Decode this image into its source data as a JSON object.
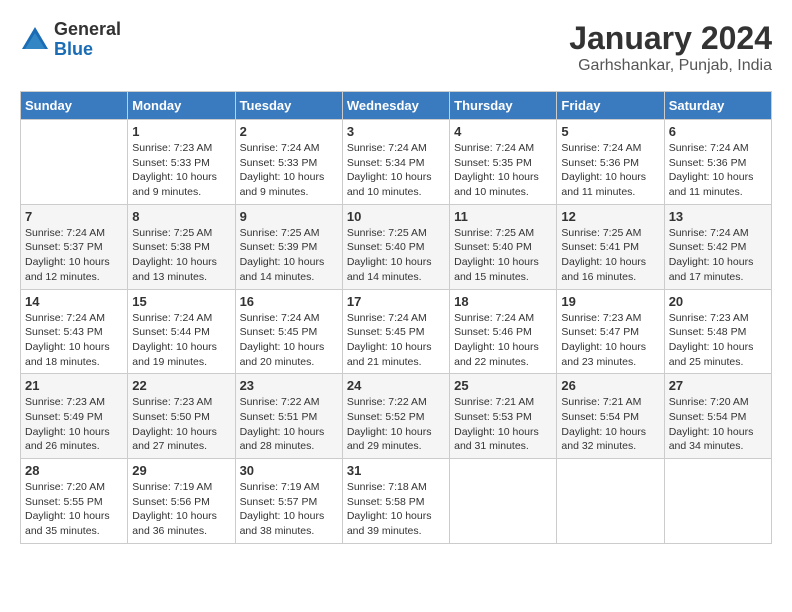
{
  "header": {
    "logo_general": "General",
    "logo_blue": "Blue",
    "title": "January 2024",
    "location": "Garhshankar, Punjab, India"
  },
  "days_of_week": [
    "Sunday",
    "Monday",
    "Tuesday",
    "Wednesday",
    "Thursday",
    "Friday",
    "Saturday"
  ],
  "weeks": [
    [
      {
        "num": "",
        "sunrise": "",
        "sunset": "",
        "daylight": ""
      },
      {
        "num": "1",
        "sunrise": "7:23 AM",
        "sunset": "5:33 PM",
        "daylight": "10 hours and 9 minutes."
      },
      {
        "num": "2",
        "sunrise": "7:24 AM",
        "sunset": "5:33 PM",
        "daylight": "10 hours and 9 minutes."
      },
      {
        "num": "3",
        "sunrise": "7:24 AM",
        "sunset": "5:34 PM",
        "daylight": "10 hours and 10 minutes."
      },
      {
        "num": "4",
        "sunrise": "7:24 AM",
        "sunset": "5:35 PM",
        "daylight": "10 hours and 10 minutes."
      },
      {
        "num": "5",
        "sunrise": "7:24 AM",
        "sunset": "5:36 PM",
        "daylight": "10 hours and 11 minutes."
      },
      {
        "num": "6",
        "sunrise": "7:24 AM",
        "sunset": "5:36 PM",
        "daylight": "10 hours and 11 minutes."
      }
    ],
    [
      {
        "num": "7",
        "sunrise": "7:24 AM",
        "sunset": "5:37 PM",
        "daylight": "10 hours and 12 minutes."
      },
      {
        "num": "8",
        "sunrise": "7:25 AM",
        "sunset": "5:38 PM",
        "daylight": "10 hours and 13 minutes."
      },
      {
        "num": "9",
        "sunrise": "7:25 AM",
        "sunset": "5:39 PM",
        "daylight": "10 hours and 14 minutes."
      },
      {
        "num": "10",
        "sunrise": "7:25 AM",
        "sunset": "5:40 PM",
        "daylight": "10 hours and 14 minutes."
      },
      {
        "num": "11",
        "sunrise": "7:25 AM",
        "sunset": "5:40 PM",
        "daylight": "10 hours and 15 minutes."
      },
      {
        "num": "12",
        "sunrise": "7:25 AM",
        "sunset": "5:41 PM",
        "daylight": "10 hours and 16 minutes."
      },
      {
        "num": "13",
        "sunrise": "7:24 AM",
        "sunset": "5:42 PM",
        "daylight": "10 hours and 17 minutes."
      }
    ],
    [
      {
        "num": "14",
        "sunrise": "7:24 AM",
        "sunset": "5:43 PM",
        "daylight": "10 hours and 18 minutes."
      },
      {
        "num": "15",
        "sunrise": "7:24 AM",
        "sunset": "5:44 PM",
        "daylight": "10 hours and 19 minutes."
      },
      {
        "num": "16",
        "sunrise": "7:24 AM",
        "sunset": "5:45 PM",
        "daylight": "10 hours and 20 minutes."
      },
      {
        "num": "17",
        "sunrise": "7:24 AM",
        "sunset": "5:45 PM",
        "daylight": "10 hours and 21 minutes."
      },
      {
        "num": "18",
        "sunrise": "7:24 AM",
        "sunset": "5:46 PM",
        "daylight": "10 hours and 22 minutes."
      },
      {
        "num": "19",
        "sunrise": "7:23 AM",
        "sunset": "5:47 PM",
        "daylight": "10 hours and 23 minutes."
      },
      {
        "num": "20",
        "sunrise": "7:23 AM",
        "sunset": "5:48 PM",
        "daylight": "10 hours and 25 minutes."
      }
    ],
    [
      {
        "num": "21",
        "sunrise": "7:23 AM",
        "sunset": "5:49 PM",
        "daylight": "10 hours and 26 minutes."
      },
      {
        "num": "22",
        "sunrise": "7:23 AM",
        "sunset": "5:50 PM",
        "daylight": "10 hours and 27 minutes."
      },
      {
        "num": "23",
        "sunrise": "7:22 AM",
        "sunset": "5:51 PM",
        "daylight": "10 hours and 28 minutes."
      },
      {
        "num": "24",
        "sunrise": "7:22 AM",
        "sunset": "5:52 PM",
        "daylight": "10 hours and 29 minutes."
      },
      {
        "num": "25",
        "sunrise": "7:21 AM",
        "sunset": "5:53 PM",
        "daylight": "10 hours and 31 minutes."
      },
      {
        "num": "26",
        "sunrise": "7:21 AM",
        "sunset": "5:54 PM",
        "daylight": "10 hours and 32 minutes."
      },
      {
        "num": "27",
        "sunrise": "7:20 AM",
        "sunset": "5:54 PM",
        "daylight": "10 hours and 34 minutes."
      }
    ],
    [
      {
        "num": "28",
        "sunrise": "7:20 AM",
        "sunset": "5:55 PM",
        "daylight": "10 hours and 35 minutes."
      },
      {
        "num": "29",
        "sunrise": "7:19 AM",
        "sunset": "5:56 PM",
        "daylight": "10 hours and 36 minutes."
      },
      {
        "num": "30",
        "sunrise": "7:19 AM",
        "sunset": "5:57 PM",
        "daylight": "10 hours and 38 minutes."
      },
      {
        "num": "31",
        "sunrise": "7:18 AM",
        "sunset": "5:58 PM",
        "daylight": "10 hours and 39 minutes."
      },
      {
        "num": "",
        "sunrise": "",
        "sunset": "",
        "daylight": ""
      },
      {
        "num": "",
        "sunrise": "",
        "sunset": "",
        "daylight": ""
      },
      {
        "num": "",
        "sunrise": "",
        "sunset": "",
        "daylight": ""
      }
    ]
  ],
  "labels": {
    "sunrise": "Sunrise:",
    "sunset": "Sunset:",
    "daylight": "Daylight:"
  }
}
